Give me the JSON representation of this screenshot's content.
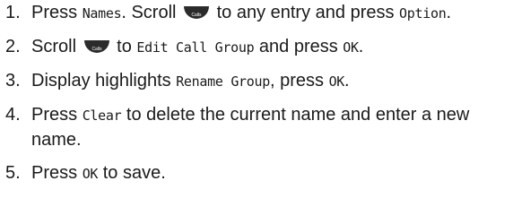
{
  "steps": [
    {
      "num": "1.",
      "t1": "Press ",
      "k1": "Names",
      "t2": ". Scroll ",
      "icon": "calls-scroll-key-icon",
      "t3": " to any entry and press ",
      "k2": "Option",
      "t4": "."
    },
    {
      "num": "2.",
      "t1": "Scroll ",
      "icon": "calls-scroll-key-icon",
      "t2": " to ",
      "k1": "Edit Call Group",
      "t3": " and press ",
      "k2": "OK",
      "t4": "."
    },
    {
      "num": "3.",
      "t1": "Display highlights ",
      "k1": "Rename Group",
      "t2": ", press ",
      "k2": "OK",
      "t3": "."
    },
    {
      "num": "4.",
      "t1": "Press ",
      "k1": "Clear",
      "t2": " to delete the current name and enter a new name."
    },
    {
      "num": "5.",
      "t1": "Press ",
      "k1": "OK",
      "t2": " to save."
    }
  ],
  "icon_label": "Calls",
  "colors": {
    "text": "#1a1a1a",
    "icon_fill": "#2b2b2b",
    "icon_label": "#ffffff"
  }
}
